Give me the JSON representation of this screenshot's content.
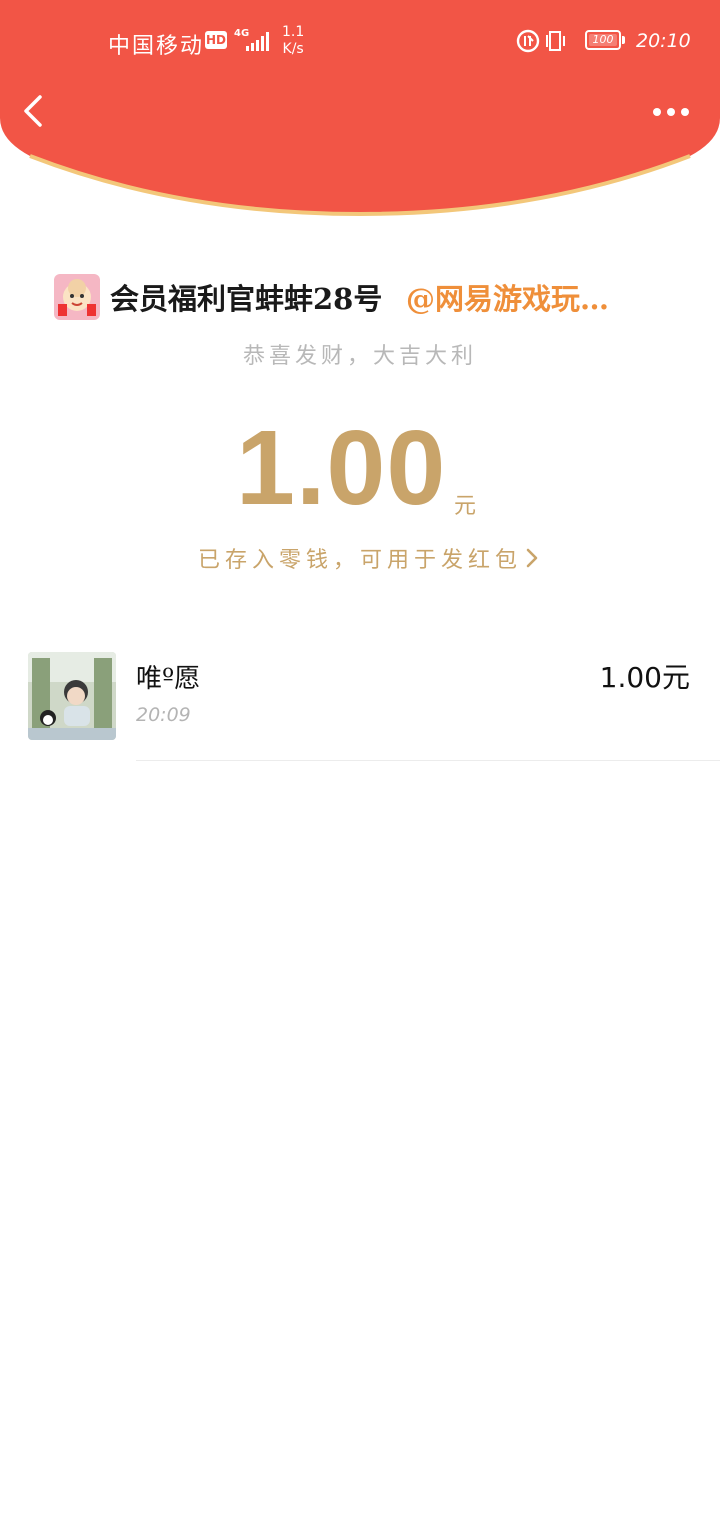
{
  "status_bar": {
    "carrier": "中国移动",
    "hd": "HD",
    "net_type": "4G",
    "net_speed_value": "1.1",
    "net_speed_unit": "K/s",
    "battery": "100",
    "time": "20:10"
  },
  "header": {
    "back_icon": "chevron-left-icon",
    "more_icon": "more-horizontal-icon",
    "background_color": "#f25546",
    "curve_border_color": "#f3c77a"
  },
  "red_packet": {
    "sender_name": "会员福利官蚌蚌28号",
    "sender_suffix": "@网易游戏玩…",
    "blessing": "恭喜发财，大吉大利",
    "amount": "1.00",
    "unit": "元",
    "change_link": "已存入零钱，可用于发红包",
    "accent_color": "#c9a46a"
  },
  "records": [
    {
      "name": "唯º愿",
      "time": "20:09",
      "amount": "1.00元"
    }
  ]
}
